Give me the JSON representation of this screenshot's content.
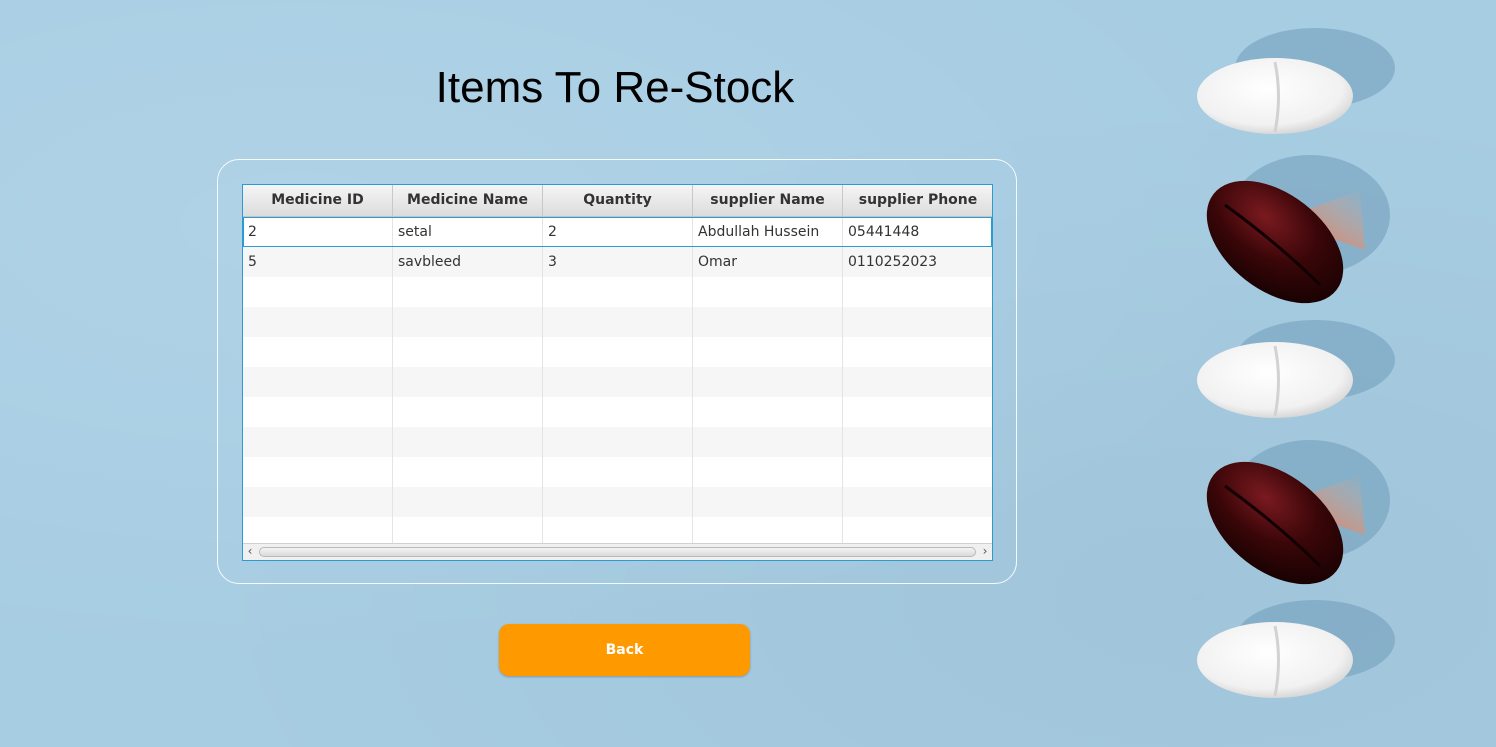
{
  "page": {
    "title": "Items To Re-Stock"
  },
  "table": {
    "columns": [
      "Medicine ID",
      "Medicine Name",
      "Quantity",
      "supplier Name",
      "supplier Phone"
    ],
    "rows": [
      [
        "2",
        "setal",
        "2",
        "Abdullah Hussein",
        "05441448"
      ],
      [
        "5",
        "savbleed",
        "3",
        "Omar",
        "0110252023"
      ]
    ],
    "selected_row": 0
  },
  "scrollbar": {
    "left_arrow": "‹",
    "right_arrow": "›"
  },
  "back_button": {
    "label": "Back"
  },
  "colors": {
    "background": "#a7cde3",
    "button": "#ff9900",
    "table_border": "#2a9bd3"
  },
  "decoration": {
    "icons": [
      "white-tablet-icon",
      "red-capsule-icon",
      "white-tablet-icon",
      "red-capsule-icon",
      "white-tablet-icon"
    ]
  }
}
